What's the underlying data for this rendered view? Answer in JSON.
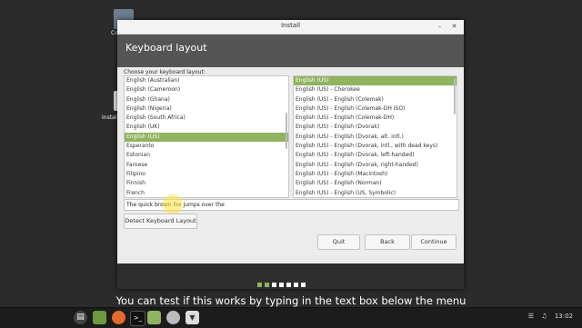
{
  "desktop": {
    "icon_labels": [
      "Co",
      "Install"
    ]
  },
  "window": {
    "title": "Install",
    "page_title": "Keyboard layout",
    "choose_label": "Choose your keyboard layout:",
    "layouts": [
      "English (Australian)",
      "English (Cameroon)",
      "English (Ghana)",
      "English (Nigeria)",
      "English (South Africa)",
      "English (UK)",
      "English (US)",
      "Esperanto",
      "Estonian",
      "Faroese",
      "Filipino",
      "Finnish",
      "French"
    ],
    "selected_layout": "English (US)",
    "variants": [
      "English (US)",
      "English (US) - Cherokee",
      "English (US) - English (Colemak)",
      "English (US) - English (Colemak-DH ISO)",
      "English (US) - English (Colemak-DH)",
      "English (US) - English (Dvorak)",
      "English (US) - English (Dvorak, alt. intl.)",
      "English (US) - English (Dvorak, intl., with dead keys)",
      "English (US) - English (Dvorak, left-handed)",
      "English (US) - English (Dvorak, right-handed)",
      "English (US) - English (Macintosh)",
      "English (US) - English (Norman)",
      "English (US) - English (US, Symbolic)"
    ],
    "selected_variant": "English (US)",
    "test_text": "The quick brown fox jumps over the",
    "buttons": {
      "detect": "Detect Keyboard Layout",
      "quit": "Quit",
      "back": "Back",
      "continue": "Continue"
    },
    "progress": {
      "total_steps": 7,
      "completed_steps": 2
    }
  },
  "subtitle": "You can test if this works by typing in the text box below the menu",
  "taskbar": {
    "clock": "13:02"
  },
  "colors": {
    "accent": "#8fb35e",
    "header": "#555555",
    "taskbar": "#1c1c1c"
  }
}
